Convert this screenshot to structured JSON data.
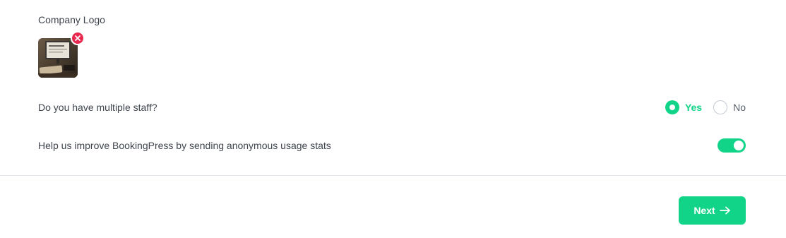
{
  "logo_section": {
    "label": "Company Logo",
    "remove_icon": "close-icon"
  },
  "staff_question": {
    "label": "Do you have multiple staff?",
    "options": [
      {
        "label": "Yes",
        "selected": true
      },
      {
        "label": "No",
        "selected": false
      }
    ]
  },
  "usage_stats": {
    "label": "Help us improve BookingPress by sending anonymous usage stats",
    "enabled": true
  },
  "footer": {
    "next_label": "Next",
    "next_icon": "arrow-right-icon"
  },
  "colors": {
    "accent": "#12d488",
    "danger": "#e8294f",
    "text": "#3f444d"
  }
}
